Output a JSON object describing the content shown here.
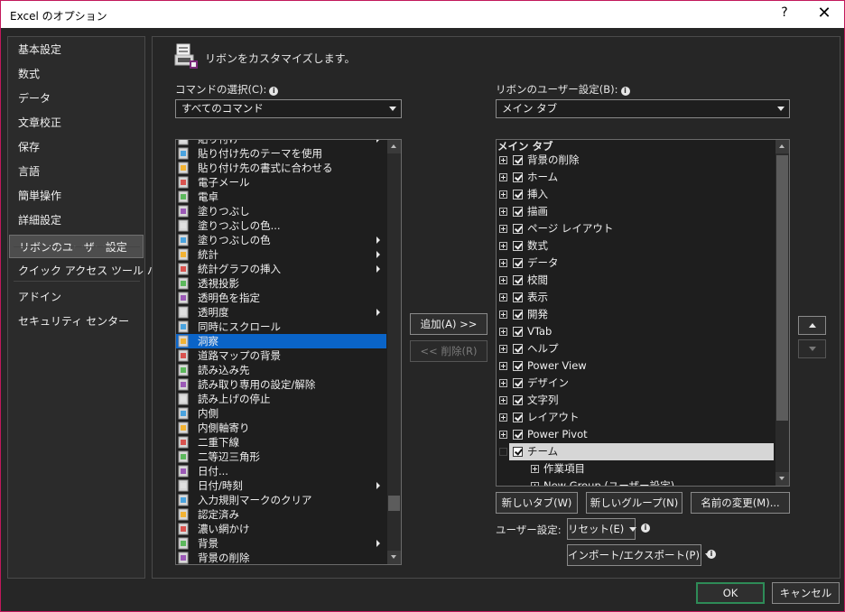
{
  "window": {
    "title": "Excel のオプション",
    "help_glyph": "?",
    "close_glyph": "✕"
  },
  "nav": {
    "items": [
      {
        "label": "基本設定"
      },
      {
        "label": "数式"
      },
      {
        "label": "データ"
      },
      {
        "label": "文章校正"
      },
      {
        "label": "保存"
      },
      {
        "label": "言語"
      },
      {
        "label": "簡単操作"
      },
      {
        "label": "詳細設定"
      },
      {
        "label": "リボンのユーザー設定",
        "selected": true
      },
      {
        "label": "クイック アクセス ツール バー"
      },
      {
        "label": "アドイン"
      },
      {
        "label": "セキュリティ センター"
      }
    ]
  },
  "page": {
    "title": "リボンをカスタマイズします。"
  },
  "commands": {
    "label": "コマンドの選択(C):",
    "dropdown_value": "すべてのコマンド",
    "items": [
      {
        "label": "貼り付け",
        "icon": "paste-icon",
        "submenu": true
      },
      {
        "label": "貼り付け先のテーマを使用",
        "icon": "paste-theme-icon"
      },
      {
        "label": "貼り付け先の書式に合わせる",
        "icon": "paste-format-icon"
      },
      {
        "label": "電子メール",
        "icon": "email-attach-icon"
      },
      {
        "label": "電卓",
        "icon": "calculator-icon"
      },
      {
        "label": "塗りつぶし",
        "icon": "fill-icon"
      },
      {
        "label": "塗りつぶしの色...",
        "icon": "fill-color-dialog-icon"
      },
      {
        "label": "塗りつぶしの色",
        "icon": "fill-color-icon",
        "submenu": true
      },
      {
        "label": "統計",
        "icon": "statistics-icon",
        "submenu": true
      },
      {
        "label": "統計グラフの挿入",
        "icon": "statistic-chart-icon",
        "submenu": true
      },
      {
        "label": "透視投影",
        "icon": "perspective-icon"
      },
      {
        "label": "透明色を指定",
        "icon": "transparent-color-icon"
      },
      {
        "label": "透明度",
        "icon": "transparency-icon",
        "submenu": true
      },
      {
        "label": "同時にスクロール",
        "icon": "sync-scroll-icon"
      },
      {
        "label": "洞察",
        "icon": "insights-icon",
        "selected": true
      },
      {
        "label": "道路マップの背景",
        "icon": "road-map-icon"
      },
      {
        "label": "読み込み先",
        "icon": "load-to-icon"
      },
      {
        "label": "読み取り専用の設定/解除",
        "icon": "read-only-icon"
      },
      {
        "label": "読み上げの停止",
        "icon": "stop-speaking-icon"
      },
      {
        "label": "内側",
        "icon": "inside-icon"
      },
      {
        "label": "内側軸寄り",
        "icon": "inside-axis-icon"
      },
      {
        "label": "二重下線",
        "icon": "double-underline-icon"
      },
      {
        "label": "二等辺三角形",
        "icon": "isosceles-triangle-icon"
      },
      {
        "label": "日付...",
        "icon": "date-icon"
      },
      {
        "label": "日付/時刻",
        "icon": "datetime-icon",
        "submenu": true
      },
      {
        "label": "入力規則マークのクリア",
        "icon": "clear-validation-icon"
      },
      {
        "label": "認定済み",
        "icon": "certified-icon"
      },
      {
        "label": "濃い網かけ",
        "icon": "dark-shading-icon"
      },
      {
        "label": "背景",
        "icon": "background-icon",
        "submenu": true
      },
      {
        "label": "背景の削除",
        "icon": "remove-background-icon"
      }
    ]
  },
  "middle": {
    "add_label": "追加(A) >>",
    "remove_label": "<< 削除(R)"
  },
  "ribbon": {
    "label": "リボンのユーザー設定(B):",
    "dropdown_value": "メイン タブ",
    "header": "メイン タブ",
    "items": [
      {
        "label": "背景の削除",
        "level": 0,
        "checked": true,
        "expand": "plus"
      },
      {
        "label": "ホーム",
        "level": 0,
        "checked": true,
        "expand": "plus"
      },
      {
        "label": "挿入",
        "level": 0,
        "checked": true,
        "expand": "plus"
      },
      {
        "label": "描画",
        "level": 0,
        "checked": true,
        "expand": "plus"
      },
      {
        "label": "ページ レイアウト",
        "level": 0,
        "checked": true,
        "expand": "plus"
      },
      {
        "label": "数式",
        "level": 0,
        "checked": true,
        "expand": "plus"
      },
      {
        "label": "データ",
        "level": 0,
        "checked": true,
        "expand": "plus"
      },
      {
        "label": "校閲",
        "level": 0,
        "checked": true,
        "expand": "plus"
      },
      {
        "label": "表示",
        "level": 0,
        "checked": true,
        "expand": "plus"
      },
      {
        "label": "開発",
        "level": 0,
        "checked": true,
        "expand": "plus"
      },
      {
        "label": "VTab",
        "level": 0,
        "checked": true,
        "expand": "plus"
      },
      {
        "label": "ヘルプ",
        "level": 0,
        "checked": true,
        "expand": "plus"
      },
      {
        "label": "Power View",
        "level": 0,
        "checked": true,
        "expand": "plus"
      },
      {
        "label": "デザイン",
        "level": 0,
        "checked": true,
        "expand": "plus"
      },
      {
        "label": "文字列",
        "level": 0,
        "checked": true,
        "expand": "plus"
      },
      {
        "label": "レイアウト",
        "level": 0,
        "checked": true,
        "expand": "plus"
      },
      {
        "label": "Power Pivot",
        "level": 0,
        "checked": true,
        "expand": "plus"
      },
      {
        "label": "チーム",
        "level": 0,
        "checked": true,
        "expand": "minus",
        "selected": true
      },
      {
        "label": "作業項目",
        "level": 1,
        "expand": "plus"
      },
      {
        "label": "New Group (ユーザー設定)",
        "level": 1,
        "expand": "plus"
      }
    ]
  },
  "ribbon_buttons": {
    "new_tab": "新しいタブ(W)",
    "new_group": "新しいグループ(N)",
    "rename": "名前の変更(M)..."
  },
  "customizations": {
    "label": "ユーザー設定:",
    "reset": "リセット(E)",
    "import_export": "インポート/エクスポート(P)"
  },
  "footer": {
    "ok": "OK",
    "cancel": "キャンセル"
  }
}
